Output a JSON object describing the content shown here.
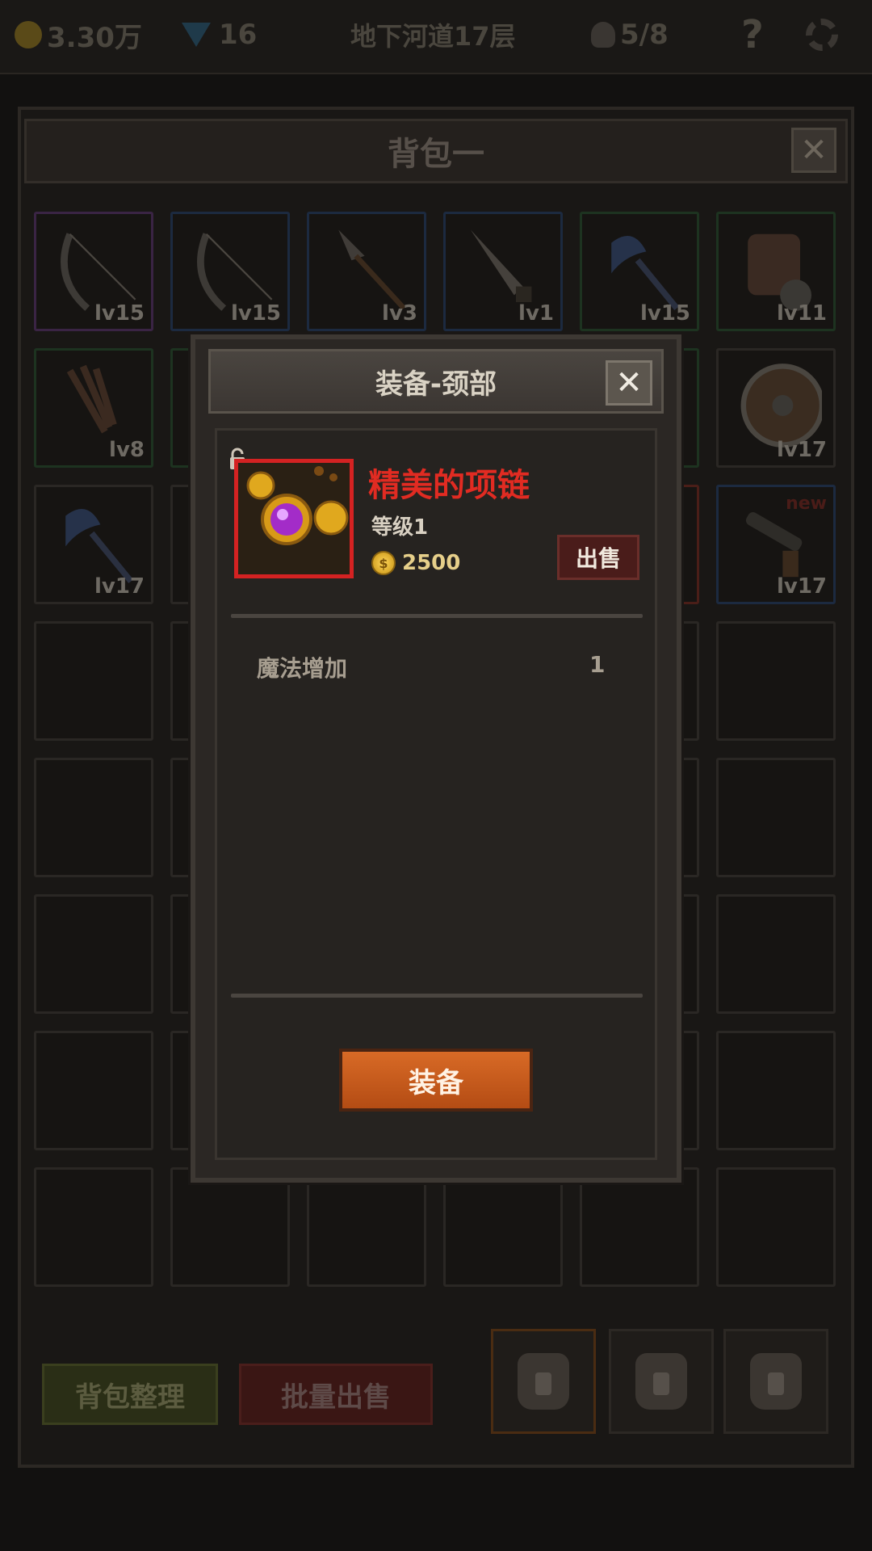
{
  "topbar": {
    "gold": "3.30万",
    "gems": "16",
    "location": "地下河道17层",
    "skull_count": "5/8",
    "help": "?"
  },
  "bag": {
    "title": "背包一",
    "close": "✕",
    "slots": [
      {
        "level": "lv15",
        "rarity": "purple",
        "icon": "bow-icon"
      },
      {
        "level": "lv15",
        "rarity": "blue",
        "icon": "bow-icon"
      },
      {
        "level": "lv3",
        "rarity": "blue",
        "icon": "spear-icon"
      },
      {
        "level": "lv1",
        "rarity": "blue",
        "icon": "dagger-icon"
      },
      {
        "level": "lv15",
        "rarity": "green",
        "icon": "axe-icon"
      },
      {
        "level": "lv11",
        "rarity": "green",
        "icon": "bracer-icon"
      },
      {
        "level": "lv8",
        "rarity": "green",
        "icon": "staff-icon"
      },
      {
        "level": "lv17",
        "rarity": "green",
        "icon": "shield-icon"
      },
      {
        "level": "lv17",
        "rarity": "none",
        "icon": "axe-icon"
      },
      {
        "level": "lv17",
        "rarity": "blue",
        "icon": "gun-icon",
        "badge": "new"
      }
    ],
    "sort_button": "背包整理",
    "bulk_sell_button": "批量出售"
  },
  "dialog": {
    "title": "装备-颈部",
    "close": "✕",
    "item_name": "精美的项链",
    "item_level": "等级1",
    "price": "2500",
    "coin_symbol": "$",
    "sell_button": "出售",
    "stats": [
      {
        "name": "魔法增加",
        "value": "1"
      }
    ],
    "equip_button": "装备"
  },
  "colors": {
    "item_name": "#e12b22",
    "equip_button": "#c85a1c",
    "sell_button": "#4a1c1a"
  }
}
